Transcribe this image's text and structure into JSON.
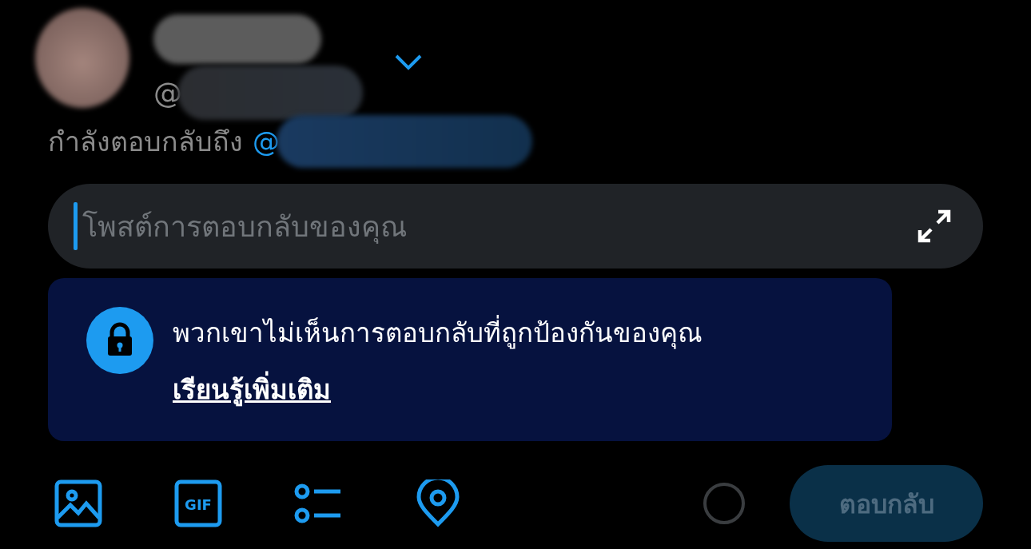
{
  "account": {
    "handle_prefix": "@",
    "menu_expanded": false
  },
  "reply_to": {
    "label": "กำลังตอบกลับถึง",
    "handle_prefix": "@"
  },
  "composer": {
    "placeholder": "โพสต์การตอบกลับของคุณ"
  },
  "notice": {
    "text": "พวกเขาไม่เห็นการตอบกลับที่ถูกป้องกันของคุณ",
    "link": "เรียนรู้เพิ่มเติม"
  },
  "toolbar": [
    {
      "kind": "image"
    },
    {
      "kind": "gif",
      "label": "GIF"
    },
    {
      "kind": "poll"
    },
    {
      "kind": "location"
    }
  ],
  "reply_button": {
    "label": "ตอบกลับ",
    "disabled": true
  }
}
